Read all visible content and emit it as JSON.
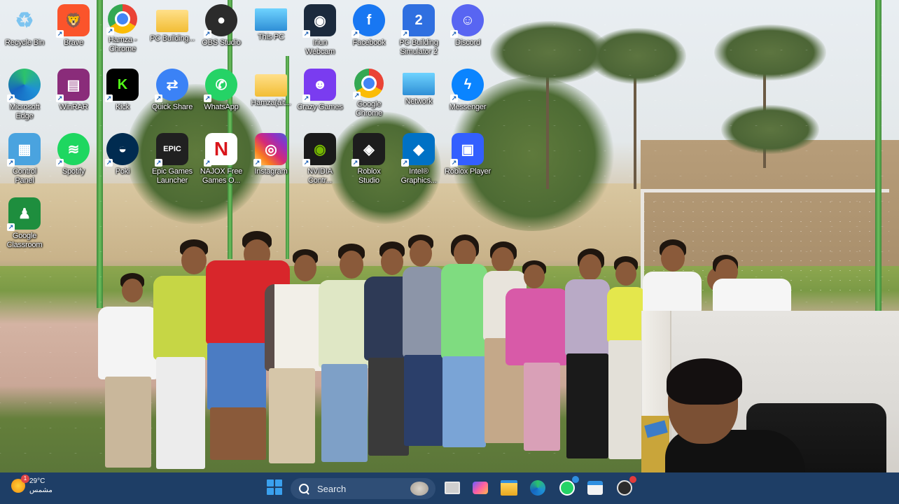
{
  "desktop": {
    "icons": [
      {
        "label": "Recycle Bin",
        "icon": "recycle-bin-icon",
        "color": "#7cc4f0"
      },
      {
        "label": "Brave",
        "icon": "brave-icon",
        "color": "#fb542b"
      },
      {
        "label": "Hamza -\nChrome",
        "icon": "chrome-icon",
        "color": "#ffffff"
      },
      {
        "label": "PC Building...",
        "icon": "folder-icon",
        "color": "#f5c242"
      },
      {
        "label": "OBS Studio",
        "icon": "obs-icon",
        "color": "#2b2b2b"
      },
      {
        "label": "This PC",
        "icon": "monitor-icon",
        "color": "#41b4e8"
      },
      {
        "label": "Iriun\nWebcam",
        "icon": "webcam-icon",
        "color": "#1b2a3d"
      },
      {
        "label": "Facebook",
        "icon": "facebook-icon",
        "color": "#1877f2"
      },
      {
        "label": "PC Building\nSimulator 2",
        "icon": "pc-building-simulator-icon",
        "color": "#2f6fe0"
      },
      {
        "label": "Discord",
        "icon": "discord-icon",
        "color": "#5865f2"
      },
      {
        "label": "Microsoft\nEdge",
        "icon": "edge-icon",
        "color": "#1e8fd6"
      },
      {
        "label": "WinRAR",
        "icon": "winrar-icon",
        "color": "#8a2c7a"
      },
      {
        "label": "Kick",
        "icon": "kick-icon",
        "color": "#53fc18"
      },
      {
        "label": "Quick Share",
        "icon": "quick-share-icon",
        "color": "#3b82f6"
      },
      {
        "label": "WhatsApp",
        "icon": "whatsapp-icon",
        "color": "#25d366"
      },
      {
        "label": "Hamza(alt...",
        "icon": "folder-icon",
        "color": "#f5c242"
      },
      {
        "label": "Crazy Games",
        "icon": "crazy-games-icon",
        "color": "#7a3cf0"
      },
      {
        "label": "Google\nChrome",
        "icon": "chrome-icon",
        "color": "#ffffff"
      },
      {
        "label": "Network",
        "icon": "network-icon",
        "color": "#2fa7e6"
      },
      {
        "label": "Messenger",
        "icon": "messenger-icon",
        "color": "#0a84ff"
      },
      {
        "label": "Control\nPanel",
        "icon": "control-panel-icon",
        "color": "#4aa3df"
      },
      {
        "label": "Spotify",
        "icon": "spotify-icon",
        "color": "#1ed760"
      },
      {
        "label": "Poki",
        "icon": "poki-icon",
        "color": "#002b50"
      },
      {
        "label": "Epic Games\nLauncher",
        "icon": "epic-games-icon",
        "color": "#202020"
      },
      {
        "label": "NAJOX Free\nGames O...",
        "icon": "najox-icon",
        "color": "#ffffff"
      },
      {
        "label": "Instagram",
        "icon": "instagram-icon",
        "color": "#d62976"
      },
      {
        "label": "NVIDIA\nContr...",
        "icon": "nvidia-icon",
        "color": "#76b900"
      },
      {
        "label": "Roblox\nStudio",
        "icon": "roblox-studio-icon",
        "color": "#1d1d1d"
      },
      {
        "label": "Intel®\nGraphics...",
        "icon": "intel-graphics-icon",
        "color": "#0071c5"
      },
      {
        "label": "Roblox Player",
        "icon": "roblox-icon",
        "color": "#335fff"
      },
      {
        "label": "Google\nClassroom",
        "icon": "google-classroom-icon",
        "color": "#1e8e3e"
      }
    ]
  },
  "taskbar": {
    "weather_temp": "29°C",
    "weather_desc": "مشمس",
    "weather_badge": "1",
    "search_placeholder": "Search",
    "apps": [
      {
        "icon": "task-view-icon"
      },
      {
        "icon": "widgets-icon"
      },
      {
        "icon": "file-explorer-icon"
      },
      {
        "icon": "edge-icon"
      },
      {
        "icon": "whatsapp-icon"
      },
      {
        "icon": "microsoft-store-icon"
      },
      {
        "icon": "obs-icon"
      }
    ]
  }
}
